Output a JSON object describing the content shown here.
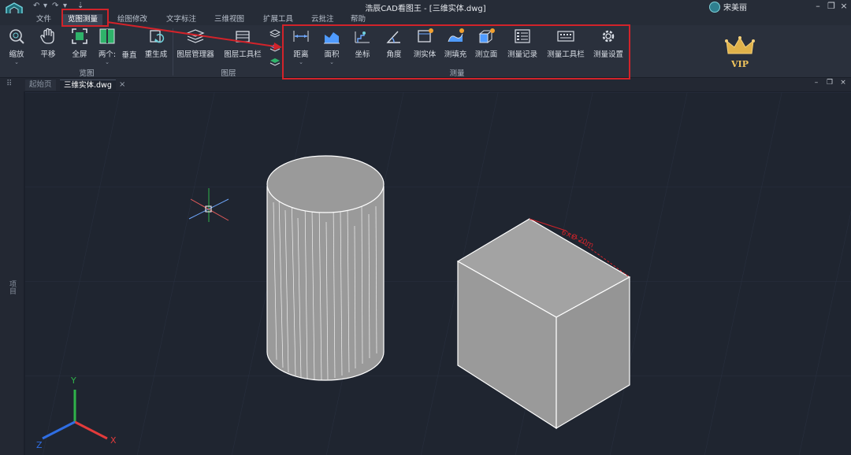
{
  "window": {
    "title": "浩辰CAD看图王 - [三维实体.dwg]",
    "user_name": "宋美丽"
  },
  "menu": {
    "tabs": [
      "文件",
      "览图测量",
      "绘图修改",
      "文字标注",
      "三维视图",
      "扩展工具",
      "云批注",
      "帮助"
    ],
    "active_index": 1
  },
  "ribbon": {
    "view_group": {
      "label": "览图",
      "tools": [
        "缩放",
        "平移",
        "全屏",
        "两个:",
        "垂直",
        "重生成"
      ]
    },
    "layer_group": {
      "label": "图层",
      "tools": [
        "图层管理器",
        "图层工具栏"
      ]
    },
    "measure_group": {
      "label": "测量",
      "tools": [
        "距离",
        "面积",
        "坐标",
        "角度",
        "测实体",
        "测填充",
        "测立面",
        "测量记录",
        "测量工具栏",
        "测量设置"
      ]
    },
    "vip_label": "VIP"
  },
  "doc_tabs": {
    "start_page": "起始页",
    "active_file": "三维实体.dwg",
    "close_glyph": "×"
  },
  "side_panel": {
    "label": "项目"
  },
  "drawing": {
    "dimension_text": "6×Ø 20m",
    "axes": {
      "x": "X",
      "y": "Y",
      "z": "Z"
    }
  },
  "colors": {
    "highlight": "#d2232a",
    "axis_x": "#e33b3b",
    "axis_y": "#2fb34a",
    "axis_z": "#2f6ee3",
    "solid_fill": "#9a9a9a"
  }
}
